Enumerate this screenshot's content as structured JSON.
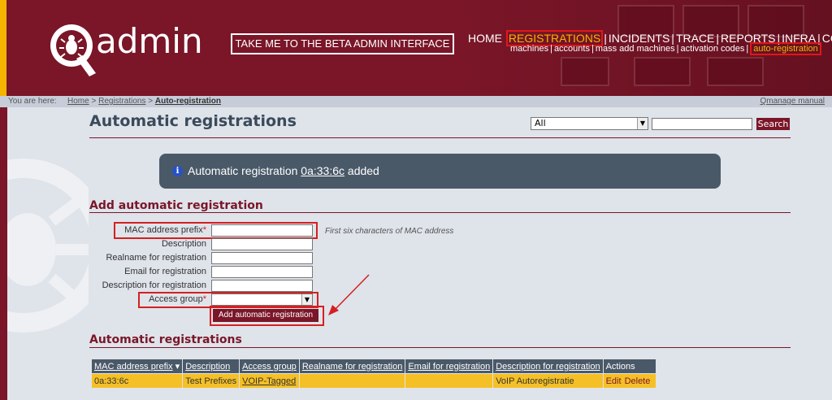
{
  "header": {
    "logo_text": "admin",
    "beta_button": "TAKE ME TO THE BETA ADMIN INTERFACE",
    "main_nav": [
      "HOME",
      "REGISTRATIONS",
      "INCIDENTS",
      "TRACE",
      "REPORTS",
      "INFRA",
      "CONFIG"
    ],
    "main_nav_active": "REGISTRATIONS",
    "sub_nav": [
      "machines",
      "accounts",
      "mass add machines",
      "activation codes",
      "auto-registration"
    ],
    "sub_nav_active": "auto-registration"
  },
  "breadcrumb": {
    "label": "You are here:",
    "items": [
      "Home",
      "Registrations",
      "Auto-registration"
    ],
    "separator": ">",
    "manual_link": "Qmanage manual"
  },
  "page": {
    "title": "Automatic registrations",
    "search": {
      "select_value": "All",
      "input_value": "",
      "button_label": "Search"
    }
  },
  "flash": {
    "prefix": "Automatic registration",
    "link": "0a:33:6c",
    "suffix": "added",
    "icon": "info-icon"
  },
  "add_form": {
    "title": "Add automatic registration",
    "fields": [
      {
        "label": "MAC address prefix",
        "required": true,
        "value": ""
      },
      {
        "label": "Description",
        "required": false,
        "value": ""
      },
      {
        "label": "Realname for registration",
        "required": false,
        "value": ""
      },
      {
        "label": "Email for registration",
        "required": false,
        "value": ""
      },
      {
        "label": "Description for registration",
        "required": false,
        "value": ""
      },
      {
        "label": "Access group",
        "required": true,
        "value": ""
      }
    ],
    "required_marker": "*",
    "mac_hint": "First six characters of MAC address",
    "submit_label": "Add automatic registration"
  },
  "list": {
    "title": "Automatic registrations",
    "columns": [
      "MAC address prefix",
      "Description",
      "Access group",
      "Realname for registration",
      "Email for registration",
      "Description for registration",
      "Actions"
    ],
    "sort_indicator": "▾",
    "rows": [
      {
        "mac": "0a:33:6c",
        "description": "Test Prefixes",
        "access_group": "VOIP-Tagged",
        "realname": "",
        "email": "",
        "reg_description": "VoIP Autoregistratie",
        "actions": [
          "Edit",
          "Delete"
        ]
      }
    ]
  },
  "colors": {
    "brand": "#7a1628",
    "accent": "#f5b400",
    "highlight": "#d42020",
    "row": "#f5c026",
    "header_cell": "#4a5968"
  }
}
